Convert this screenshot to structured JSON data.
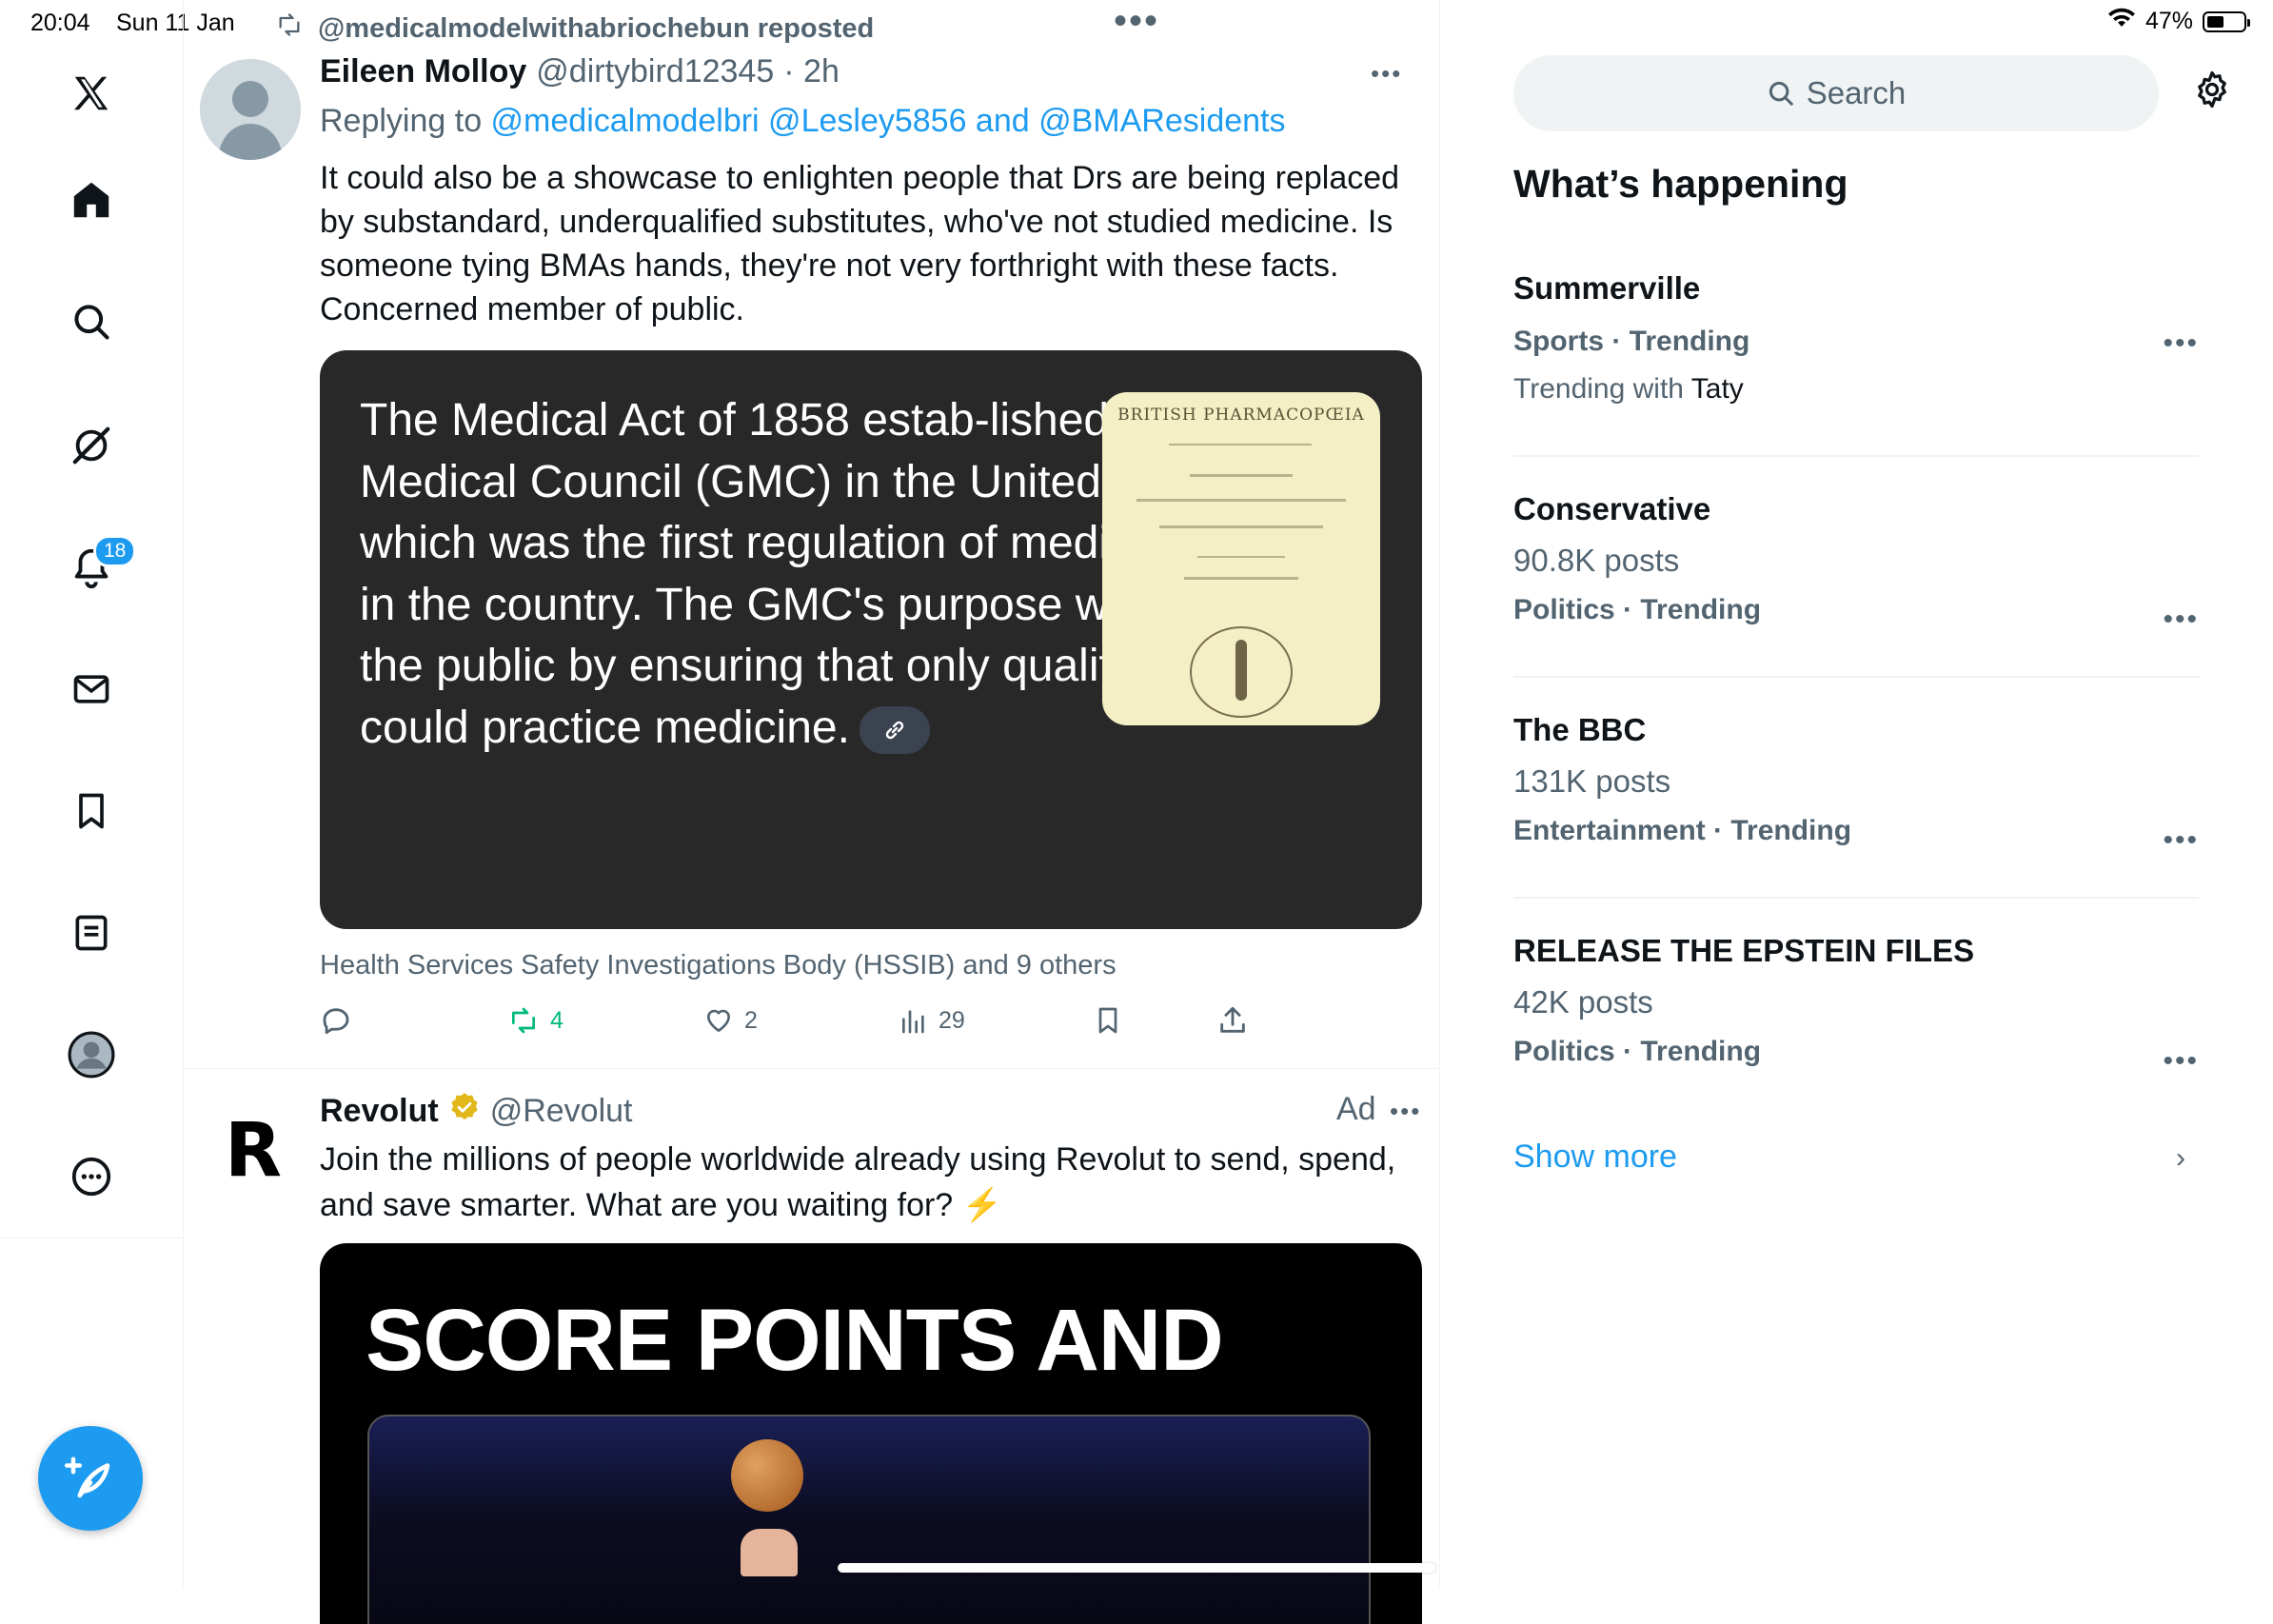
{
  "status_bar": {
    "time": "20:04",
    "date": "Sun 11 Jan",
    "battery": "47%",
    "battery_level": 0.47
  },
  "nav": {
    "items": [
      "x-logo",
      "home",
      "search",
      "grok",
      "notifications",
      "messages",
      "bookmarks",
      "lists",
      "profile",
      "more"
    ],
    "notification_count": "18"
  },
  "tweet": {
    "repost_label": "@medicalmodelwithabriochebun reposted",
    "author_name": "Eileen Molloy",
    "author_handle": "@dirtybird12345",
    "time": "· 2h",
    "replying_prefix": "Replying to ",
    "replying_to": "@medicalmodelbri @Lesley5856 and @BMAResidents",
    "text": "It could also be a showcase to enlighten people that Drs are being replaced by substandard, underqualified substitutes, who've not studied medicine. Is someone tying BMAs hands, they're not very forthright with these facts. Concerned member of public.",
    "media_text": "The Medical Act of 1858 estab-lished the General Medical Council (GMC) in the United Kingdom, which was the first regulation of medical practice in the country. The GMC's purpose was to protect the public by ensuring that only qualified doctors could practice medicine.",
    "media_image_title": "BRITISH PHARMACOPŒIA",
    "tagged": "Health Services Safety Investigations Body (HSSIB) and 9 others",
    "retweets": "4",
    "likes": "2",
    "views": "29"
  },
  "ad": {
    "author_name": "Revolut",
    "author_handle": "@Revolut",
    "label": "Ad",
    "text": "Join the millions of people worldwide already using Revolut to send, spend, and save smarter. What are you waiting for? ⚡",
    "logo_letter": "R",
    "media_headline": "SCORE POINTS AND"
  },
  "sidebar": {
    "search_placeholder": "Search",
    "section_title": "What’s happening",
    "trends": [
      {
        "title": "Summerville",
        "meta": "Sports · Trending",
        "sub_prefix": "Trending with ",
        "sub_name": "Taty"
      },
      {
        "title": "Conservative",
        "posts": "90.8K posts",
        "meta": "Politics · Trending"
      },
      {
        "title": "The BBC",
        "posts": "131K posts",
        "meta": "Entertainment · Trending"
      },
      {
        "title": "RELEASE THE EPSTEIN FILES",
        "posts": "42K posts",
        "meta": "Politics · Trending"
      }
    ],
    "show_more": "Show more"
  },
  "colors": {
    "accent": "#1d9bf0",
    "retweet_green": "#00ba7c",
    "muted": "#536471",
    "text": "#0f1419"
  }
}
